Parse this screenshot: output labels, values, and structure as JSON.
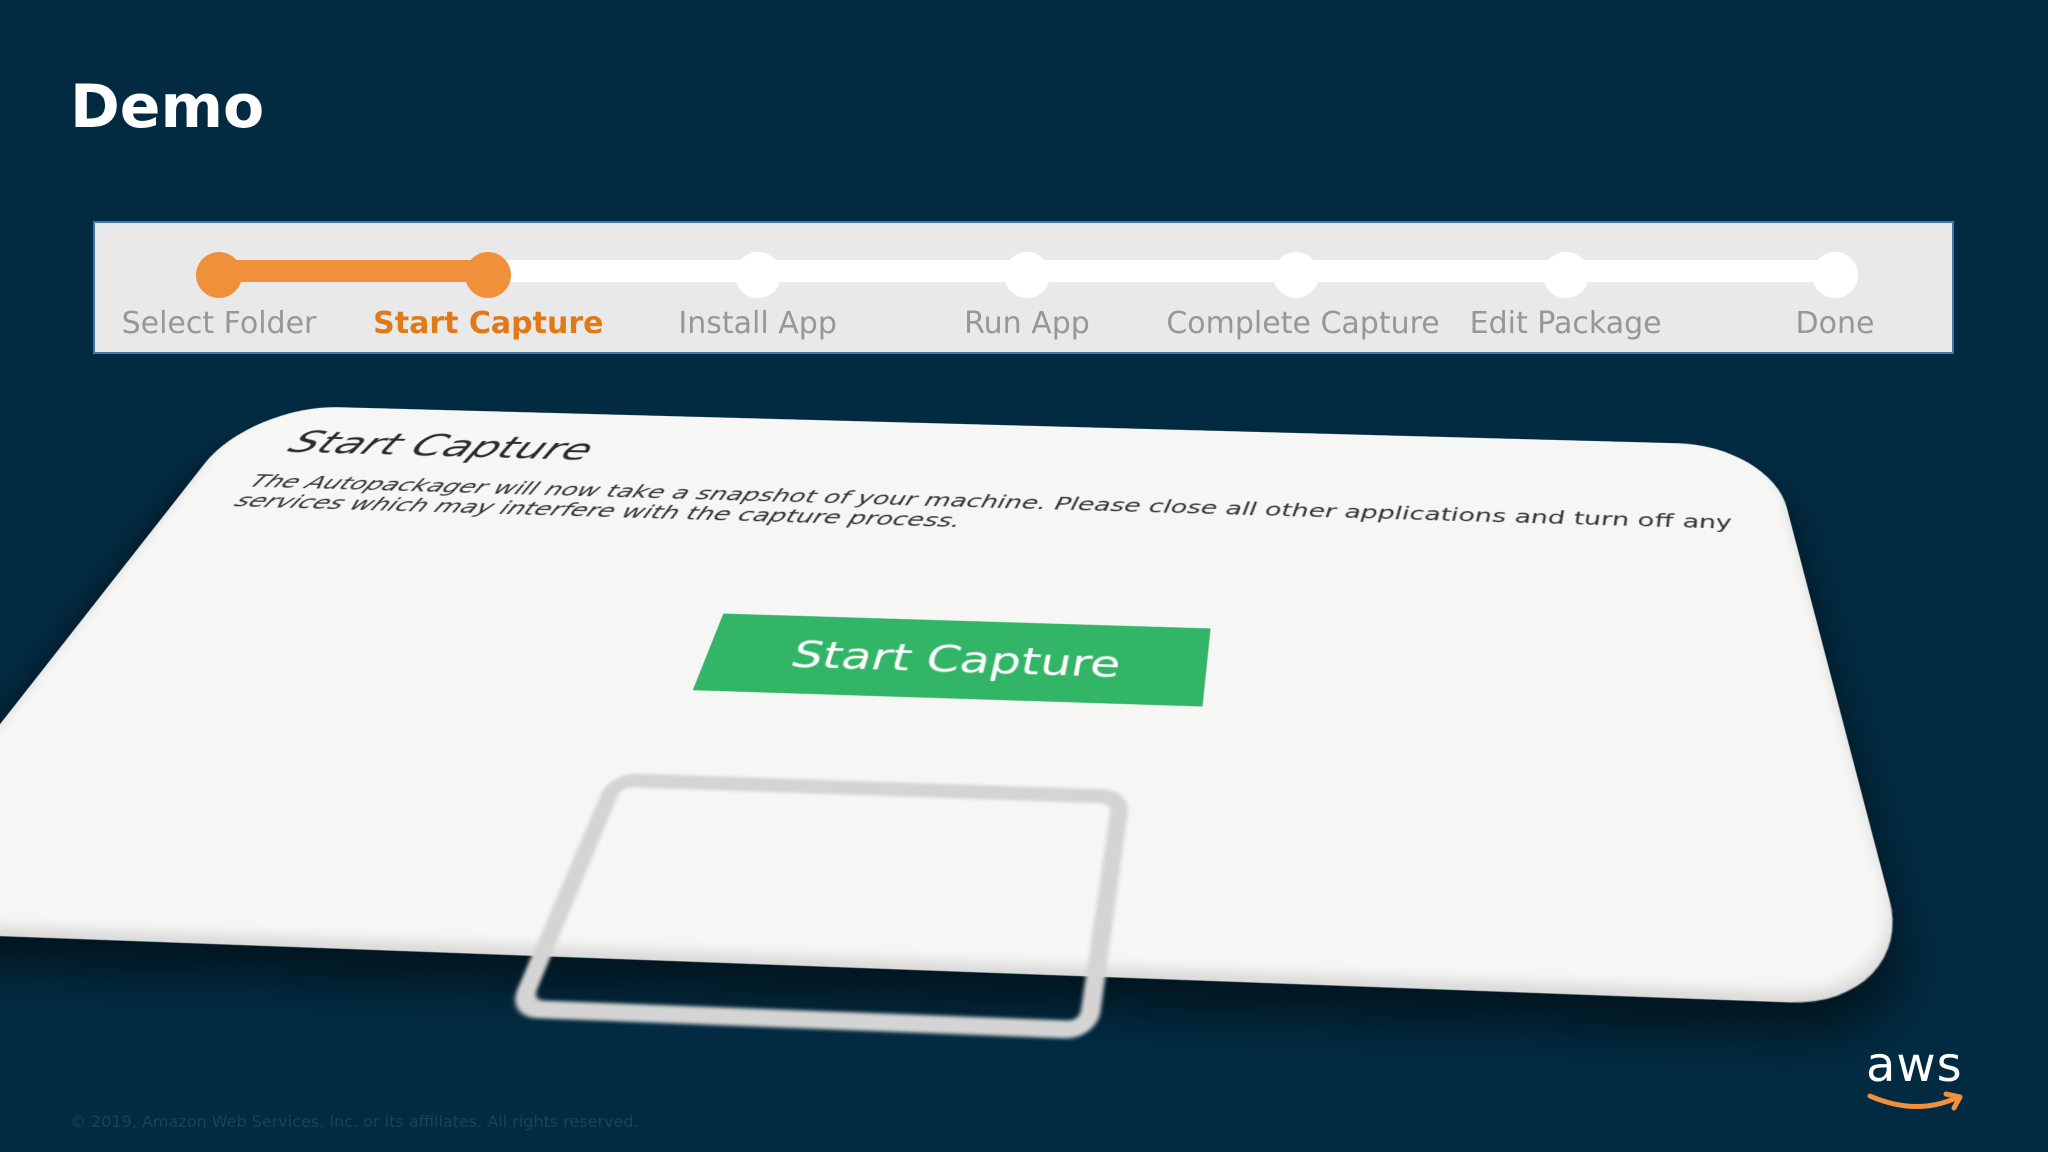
{
  "slide": {
    "title": "Demo",
    "copyright": "© 2019, Amazon Web Services, Inc. or its affiliates. All rights reserved."
  },
  "stepper": {
    "progress": 0.1667,
    "steps": [
      {
        "label": "Select Folder",
        "state": "done"
      },
      {
        "label": "Start Capture",
        "state": "active"
      },
      {
        "label": "Install App",
        "state": "pending"
      },
      {
        "label": "Run App",
        "state": "pending"
      },
      {
        "label": "Complete Capture",
        "state": "pending"
      },
      {
        "label": "Edit Package",
        "state": "pending"
      },
      {
        "label": "Done",
        "state": "pending"
      }
    ]
  },
  "capture_panel": {
    "title": "Start Capture",
    "description": "The Autopackager will now take a snapshot of your machine. Please close all other applications and turn off any services which may interfere with the capture process.",
    "button_label": "Start Capture"
  },
  "logo": {
    "text": "aws",
    "smile_color": "#f0903a"
  },
  "colors": {
    "background": "#022b42",
    "accent": "#f0903a",
    "button": "#32b566"
  }
}
